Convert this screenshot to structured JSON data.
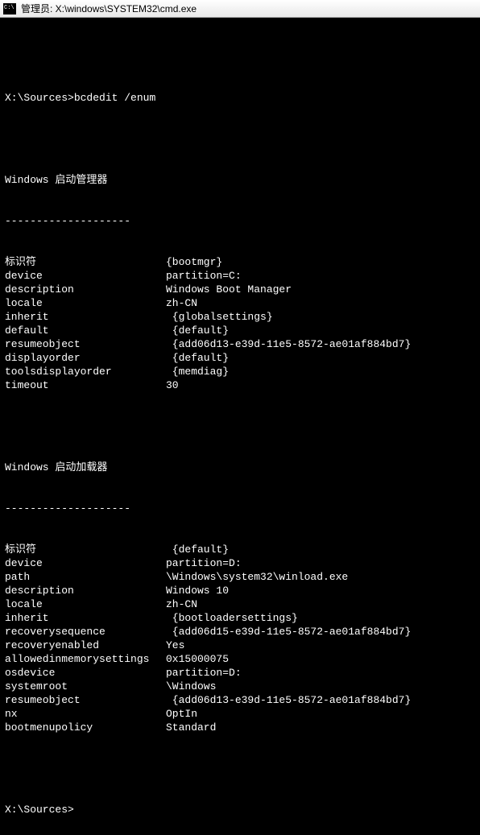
{
  "titlebar": {
    "title": "管理员: X:\\windows\\SYSTEM32\\cmd.exe"
  },
  "prompt1": {
    "path": "X:\\Sources>",
    "command": "bcdedit /enum"
  },
  "section1": {
    "heading": "Windows 启动管理器",
    "divider": "--------------------",
    "rows": [
      {
        "key": "标识符",
        "val": "{bootmgr}"
      },
      {
        "key": "device",
        "val": "partition=C:"
      },
      {
        "key": "description",
        "val": "Windows Boot Manager"
      },
      {
        "key": "locale",
        "val": "zh-CN"
      },
      {
        "key": "inherit",
        "val": " {globalsettings}"
      },
      {
        "key": "default",
        "val": " {default}"
      },
      {
        "key": "resumeobject",
        "val": " {add06d13-e39d-11e5-8572-ae01af884bd7}"
      },
      {
        "key": "displayorder",
        "val": " {default}"
      },
      {
        "key": "toolsdisplayorder",
        "val": " {memdiag}"
      },
      {
        "key": "timeout",
        "val": "30"
      }
    ]
  },
  "section2": {
    "heading": "Windows 启动加载器",
    "divider": "--------------------",
    "rows": [
      {
        "key": "标识符",
        "val": " {default}"
      },
      {
        "key": "device",
        "val": "partition=D:"
      },
      {
        "key": "path",
        "val": "\\Windows\\system32\\winload.exe"
      },
      {
        "key": "description",
        "val": "Windows 10"
      },
      {
        "key": "locale",
        "val": "zh-CN"
      },
      {
        "key": "inherit",
        "val": " {bootloadersettings}"
      },
      {
        "key": "recoverysequence",
        "val": " {add06d15-e39d-11e5-8572-ae01af884bd7}"
      },
      {
        "key": "recoveryenabled",
        "val": "Yes"
      },
      {
        "key": "allowedinmemorysettings",
        "val": "0x15000075"
      },
      {
        "key": "osdevice",
        "val": "partition=D:"
      },
      {
        "key": "systemroot",
        "val": "\\Windows"
      },
      {
        "key": "resumeobject",
        "val": " {add06d13-e39d-11e5-8572-ae01af884bd7}"
      },
      {
        "key": "nx",
        "val": "OptIn"
      },
      {
        "key": "bootmenupolicy",
        "val": "Standard"
      }
    ]
  },
  "prompt2": {
    "path": "X:\\Sources>"
  }
}
